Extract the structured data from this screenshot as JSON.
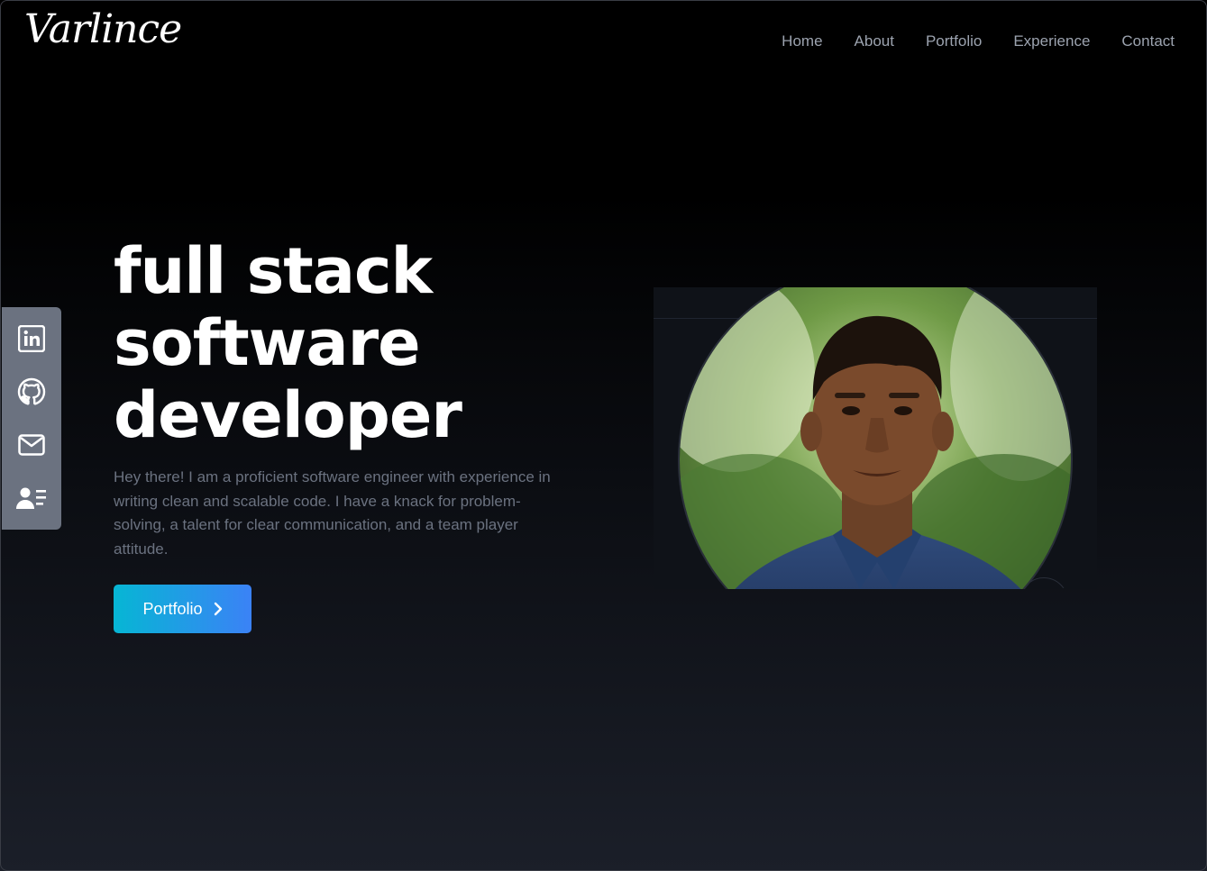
{
  "brand": {
    "logo_text": "Varlince"
  },
  "nav": {
    "items": [
      {
        "label": "Home"
      },
      {
        "label": "About"
      },
      {
        "label": "Portfolio"
      },
      {
        "label": "Experience"
      },
      {
        "label": "Contact"
      }
    ]
  },
  "social": {
    "background": "#6b7280",
    "icons": [
      "linkedin-icon",
      "github-icon",
      "mail-icon",
      "resume-icon"
    ]
  },
  "hero": {
    "title_lines": [
      "full stack",
      "software",
      "developer"
    ],
    "intro": "Hey there! I am a proficient software engineer with experience in writing clean and scalable code. I have a knack for problem-solving, a talent for clear communication, and a team player attitude.",
    "cta_label": "Portfolio",
    "cta_icon": "chevron-right-icon",
    "cta_gradient": [
      "#06b6d4",
      "#3b82f6"
    ]
  }
}
